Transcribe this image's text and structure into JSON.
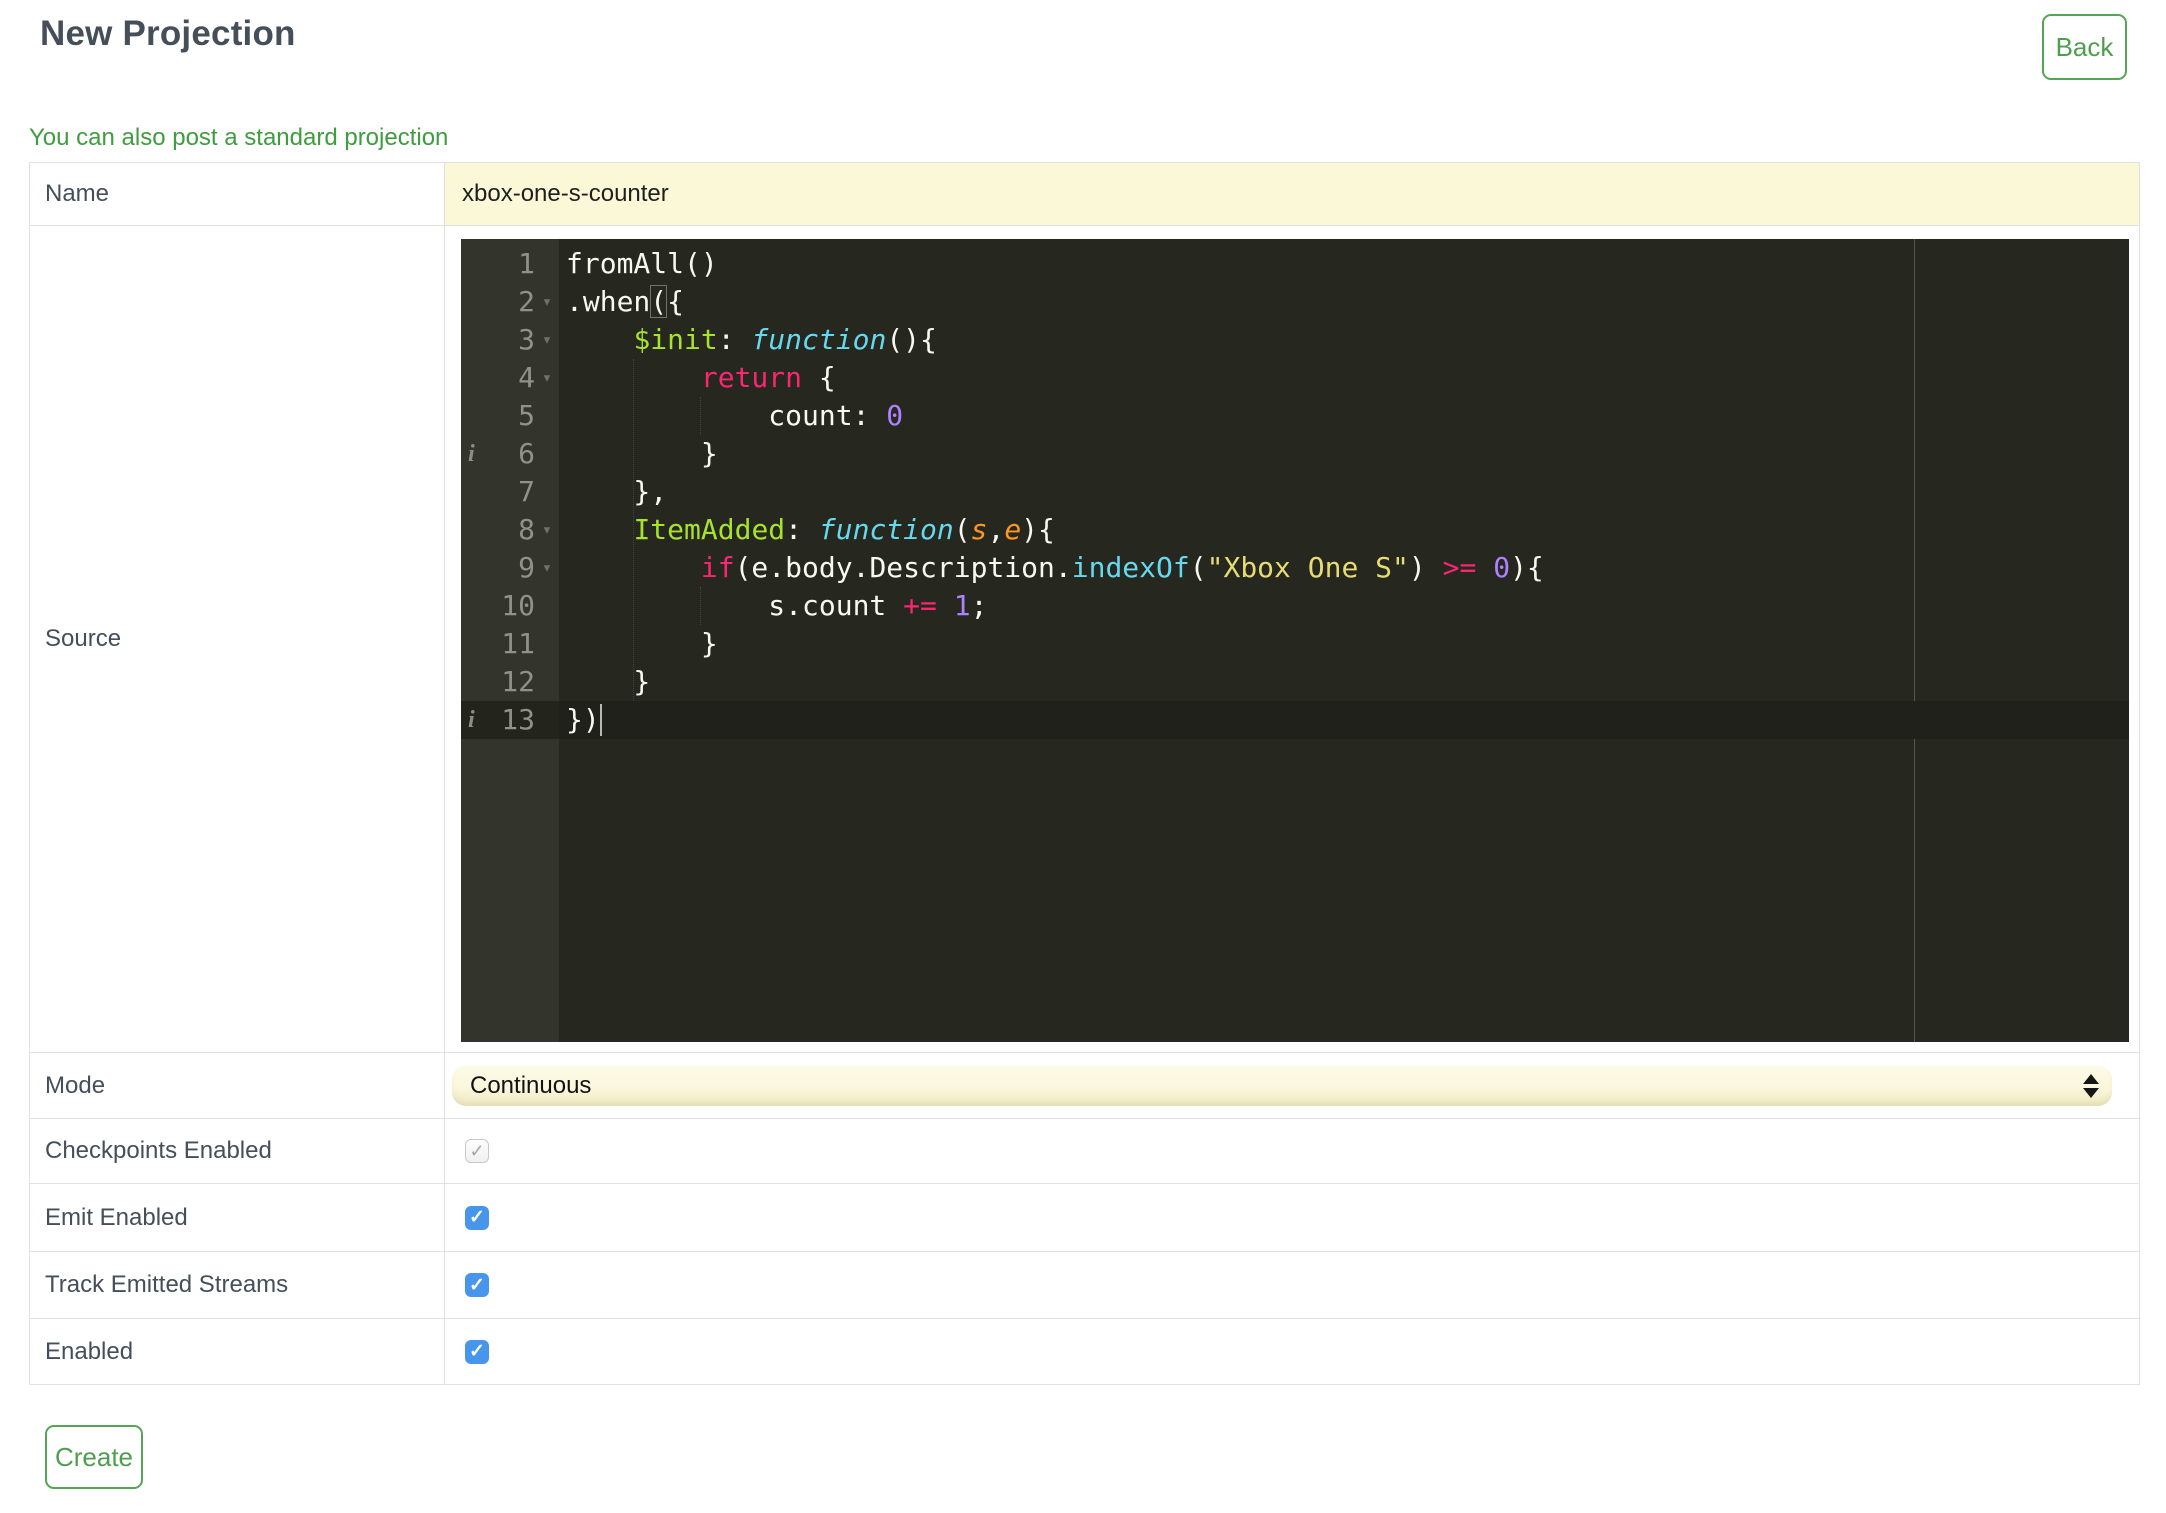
{
  "header": {
    "title": "New Projection",
    "back_label": "Back"
  },
  "subheader": {
    "link_text": "You can also post a standard projection"
  },
  "form": {
    "name": {
      "label": "Name",
      "value": "xbox-one-s-counter"
    },
    "source": {
      "label": "Source"
    },
    "mode": {
      "label": "Mode",
      "value": "Continuous"
    },
    "checkpoints": {
      "label": "Checkpoints Enabled",
      "checked": true,
      "disabled": true
    },
    "emit": {
      "label": "Emit Enabled",
      "checked": true,
      "disabled": false
    },
    "track": {
      "label": "Track Emitted Streams",
      "checked": true,
      "disabled": false
    },
    "enabled": {
      "label": "Enabled",
      "checked": true,
      "disabled": false
    }
  },
  "actions": {
    "create_label": "Create"
  },
  "icons": {
    "check": "✓",
    "fold": "▾",
    "info": "i"
  },
  "colors": {
    "heading_text": "#454f5a",
    "accent_green": "#56a556",
    "link_green": "#3f9c3f",
    "checkbox_blue": "#4796ec",
    "input_yellow": "#fbf8d8",
    "editor_background": "#26271f",
    "editor_gutter": "#33342c",
    "table_border": "#e1e1e1"
  },
  "editor": {
    "active_line": 13,
    "print_margin_column": 80,
    "annotations": {
      "info_lines": [
        6,
        13
      ],
      "fold_lines": [
        2,
        3,
        4,
        8,
        9
      ]
    },
    "lines": [
      {
        "num": 1,
        "tokens": [
          [
            "w",
            "fromAll()"
          ]
        ]
      },
      {
        "num": 2,
        "tokens": [
          [
            "w",
            ".when"
          ],
          [
            "bh",
            "("
          ],
          [
            "w",
            "{"
          ]
        ]
      },
      {
        "num": 3,
        "tokens": [
          [
            "w",
            "    "
          ],
          [
            "e",
            "$init"
          ],
          [
            "w",
            ": "
          ],
          [
            "f",
            "function"
          ],
          [
            "w",
            "(){"
          ]
        ]
      },
      {
        "num": 4,
        "tokens": [
          [
            "w",
            "        "
          ],
          [
            "k",
            "return"
          ],
          [
            "w",
            " {"
          ]
        ]
      },
      {
        "num": 5,
        "tokens": [
          [
            "w",
            "            count: "
          ],
          [
            "n",
            "0"
          ]
        ]
      },
      {
        "num": 6,
        "tokens": [
          [
            "w",
            "        }"
          ]
        ]
      },
      {
        "num": 7,
        "tokens": [
          [
            "w",
            "    },"
          ]
        ]
      },
      {
        "num": 8,
        "tokens": [
          [
            "w",
            "    "
          ],
          [
            "e",
            "ItemAdded"
          ],
          [
            "w",
            ": "
          ],
          [
            "f",
            "function"
          ],
          [
            "w",
            "("
          ],
          [
            "a",
            "s"
          ],
          [
            "w",
            ","
          ],
          [
            "a",
            "e"
          ],
          [
            "w",
            "){"
          ]
        ]
      },
      {
        "num": 9,
        "tokens": [
          [
            "w",
            "        "
          ],
          [
            "k",
            "if"
          ],
          [
            "w",
            "(e.body.Description."
          ],
          [
            "m",
            "indexOf"
          ],
          [
            "w",
            "("
          ],
          [
            "s",
            "\"Xbox One S\""
          ],
          [
            "w",
            ") "
          ],
          [
            "k",
            ">="
          ],
          [
            "w",
            " "
          ],
          [
            "n",
            "0"
          ],
          [
            "w",
            "){"
          ]
        ]
      },
      {
        "num": 10,
        "tokens": [
          [
            "w",
            "            s.count "
          ],
          [
            "k",
            "+="
          ],
          [
            "w",
            " "
          ],
          [
            "n",
            "1"
          ],
          [
            "w",
            ";"
          ]
        ]
      },
      {
        "num": 11,
        "tokens": [
          [
            "w",
            "        }"
          ]
        ]
      },
      {
        "num": 12,
        "tokens": [
          [
            "w",
            "    }"
          ]
        ]
      },
      {
        "num": 13,
        "tokens": [
          [
            "w",
            "})"
          ]
        ]
      }
    ]
  }
}
